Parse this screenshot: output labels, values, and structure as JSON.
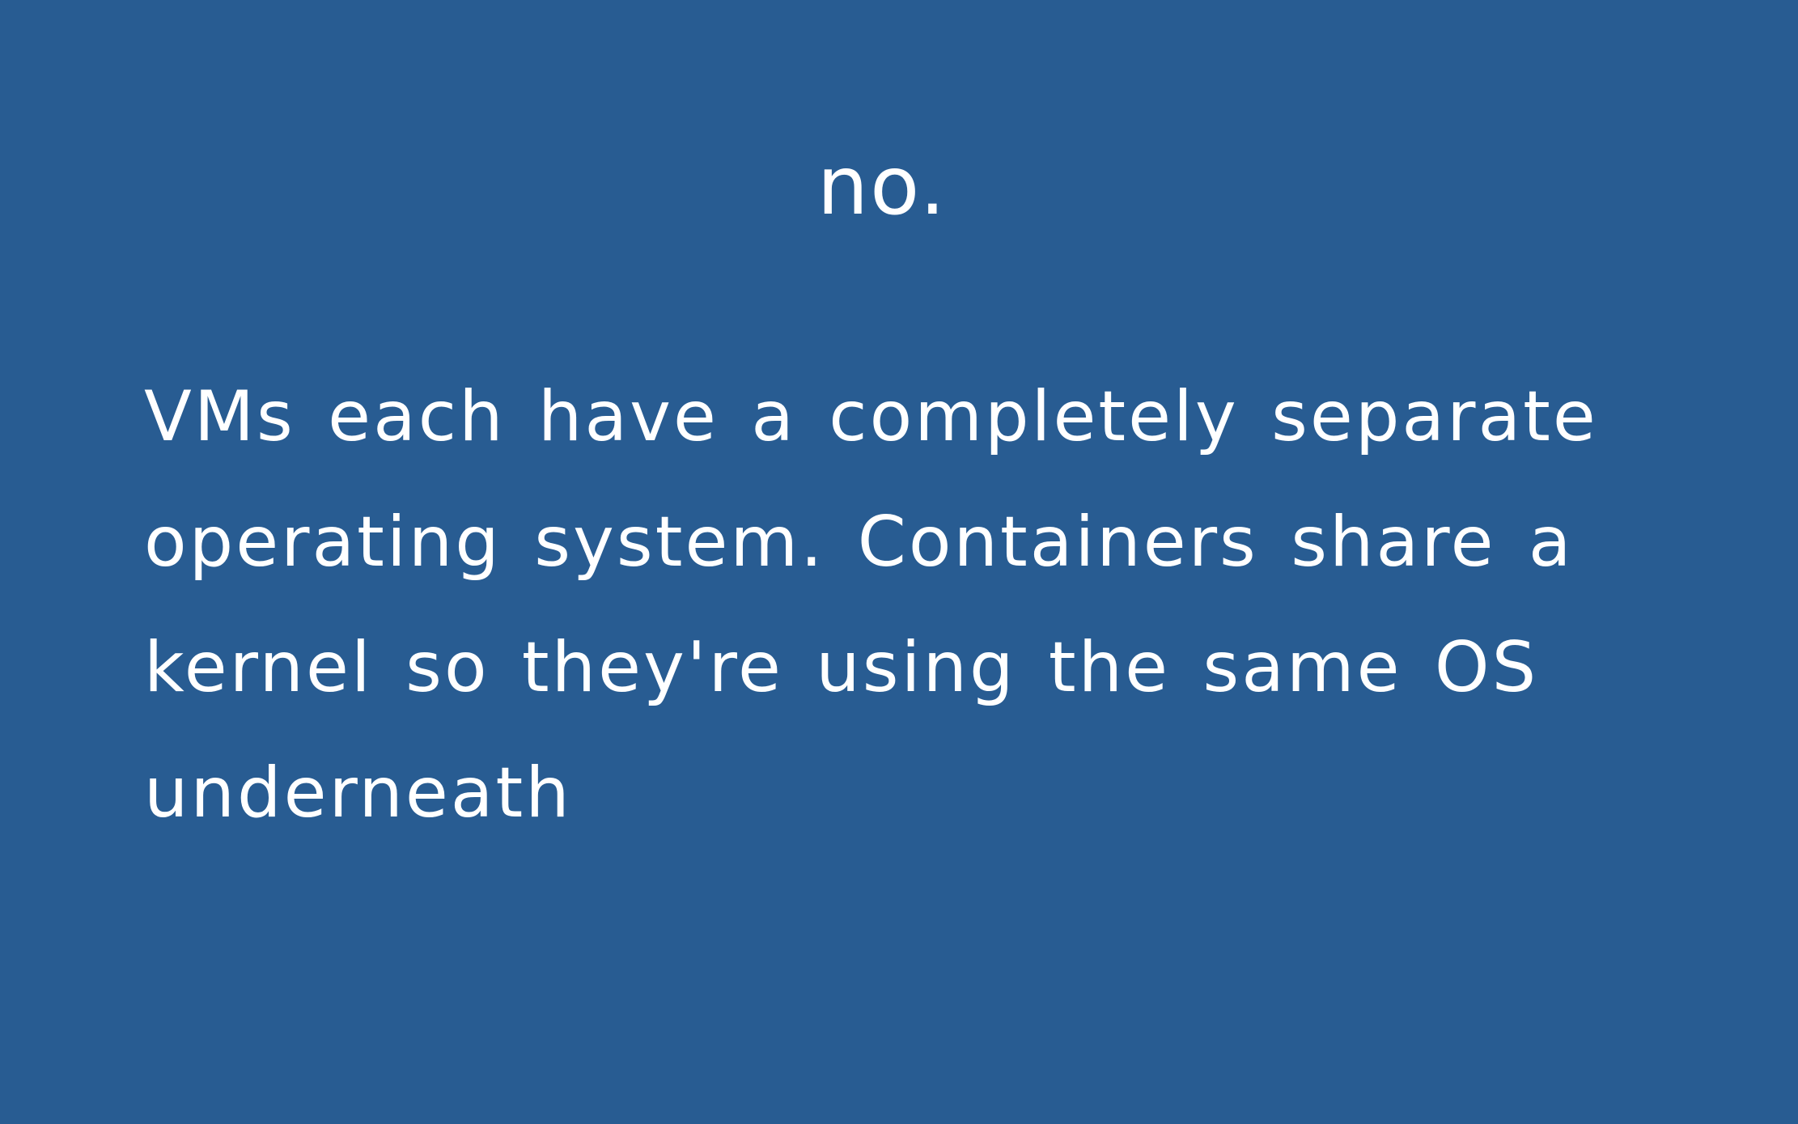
{
  "slide": {
    "heading": "no.",
    "body": "VMs each have a completely separate operating system. Containers share a kernel so they're using the same OS underneath"
  },
  "colors": {
    "background": "#285c92",
    "text": "#ffffff"
  }
}
